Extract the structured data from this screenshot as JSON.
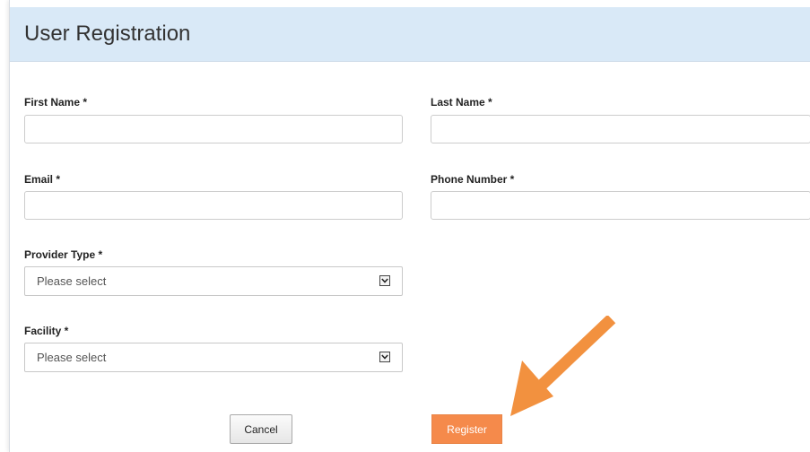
{
  "header": {
    "title": "User Registration"
  },
  "fields": {
    "first_name": {
      "label": "First Name *",
      "value": ""
    },
    "last_name": {
      "label": "Last Name *",
      "value": ""
    },
    "email": {
      "label": "Email *",
      "value": ""
    },
    "phone_number": {
      "label": "Phone Number *",
      "value": ""
    },
    "provider_type": {
      "label": "Provider Type *",
      "selected": "Please select"
    },
    "facility": {
      "label": "Facility *",
      "selected": "Please select"
    }
  },
  "buttons": {
    "cancel_label": "Cancel",
    "register_label": "Register"
  },
  "icons": {
    "dropdown": "chevron-down-icon",
    "annotation": "arrow-pointer-icon"
  },
  "colors": {
    "header_background": "#d9e9f7",
    "register_button": "#f58a4b",
    "annotation_arrow": "#f2913f"
  }
}
